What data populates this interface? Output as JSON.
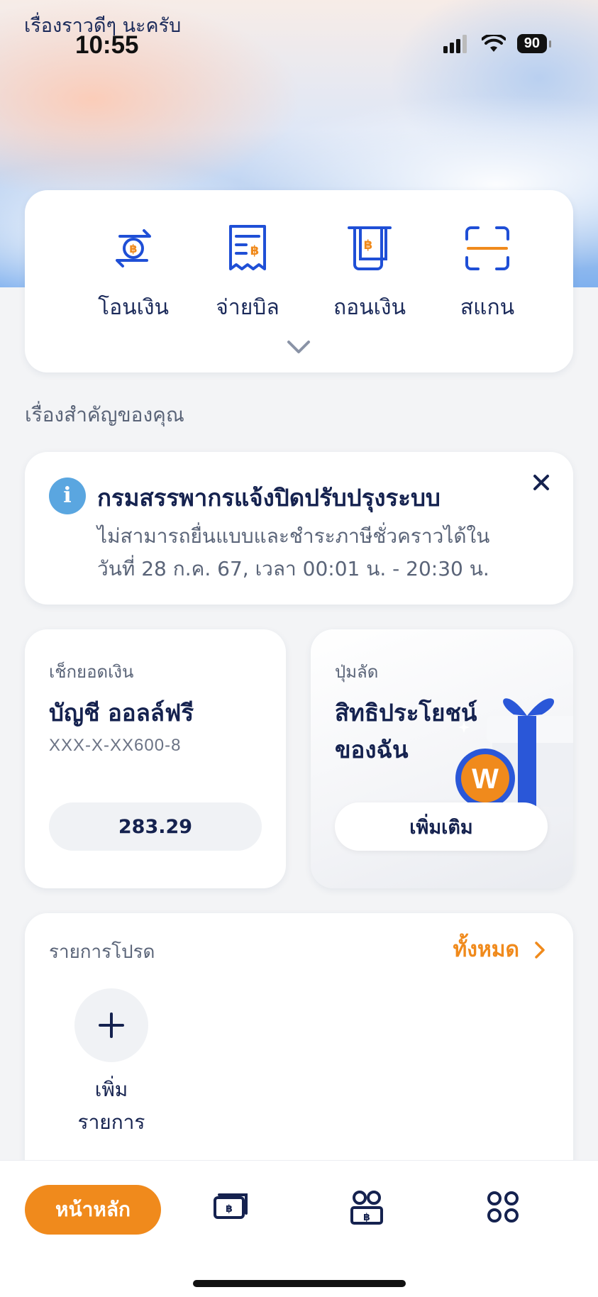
{
  "status_bar": {
    "greeting": "เรื่องราวดีๆ นะครับ",
    "time": "10:55",
    "battery": "90"
  },
  "quick_actions": [
    {
      "label": "โอนเงิน",
      "icon": "transfer-icon"
    },
    {
      "label": "จ่ายบิล",
      "icon": "bill-icon"
    },
    {
      "label": "ถอนเงิน",
      "icon": "withdraw-icon"
    },
    {
      "label": "สแกน",
      "icon": "scan-icon"
    }
  ],
  "section_title": "เรื่องสำคัญของคุณ",
  "notice": {
    "title": "กรมสรรพากรแจ้งปิดปรับปรุงระบบ",
    "body_line1": "ไม่สามารถยื่นแบบและชำระภาษีชั่วคราวได้ใน",
    "body_line2": "วันที่ 28 ก.ค. 67, เวลา 00:01 น. - 20:30 น."
  },
  "balance_card": {
    "label": "เช็กยอดเงิน",
    "account_name": "บัญชี ออลล์ฟรี",
    "account_number": "XXX-X-XX600-8",
    "balance": "283.29"
  },
  "shortcut_card": {
    "label": "ปุ่มลัด",
    "title_line1": "สิทธิประโยชน์",
    "title_line2": "ของฉัน",
    "button": "เพิ่มเติม"
  },
  "favorites": {
    "title": "รายการโปรด",
    "view_all": "ทั้งหมด",
    "add_line1": "เพิ่ม",
    "add_line2": "รายการ"
  },
  "bottom_nav": {
    "home": "หน้าหลัก"
  },
  "colors": {
    "accent": "#f08a1c",
    "primary_blue": "#1f4fd6",
    "navy_text": "#15224f"
  }
}
